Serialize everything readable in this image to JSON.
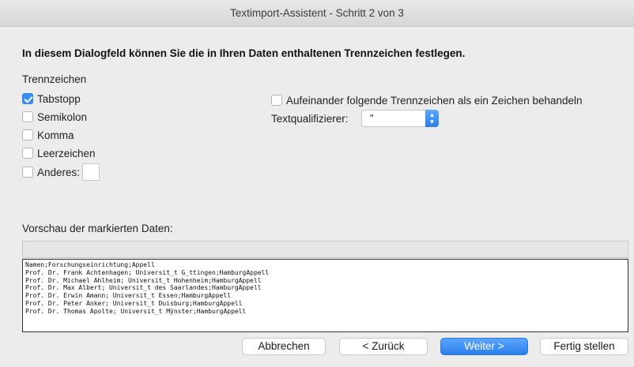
{
  "window": {
    "title": "Textimport-Assistent - Schritt 2 von 3"
  },
  "heading": "In diesem Dialogfeld können Sie die in Ihren Daten enthaltenen Trennzeichen festlegen.",
  "delimiters": {
    "label": "Trennzeichen",
    "items": [
      {
        "label": "Tabstopp",
        "checked": true
      },
      {
        "label": "Semikolon",
        "checked": false
      },
      {
        "label": "Komma",
        "checked": false
      },
      {
        "label": "Leerzeichen",
        "checked": false
      },
      {
        "label": "Anderes:",
        "checked": false
      }
    ]
  },
  "consecutive": {
    "label": "Aufeinander folgende Trennzeichen als ein Zeichen behandeln",
    "checked": false
  },
  "qualifier": {
    "label": "Textqualifizierer:",
    "value": "\""
  },
  "preview": {
    "label": "Vorschau der markierten Daten:",
    "lines": [
      "Namen;Forschungseinrichtung;Appell",
      "Prof. Dr. Frank Achtenhagen; Universit_t G_ttingen;HamburgAppell",
      "Prof. Dr. Michael Ahlheim; Universit_t Hohenheim;HamburgAppell",
      "Prof. Dr. Max Albert; Universit_t des Saarlandes;HamburgAppell",
      "Prof. Dr. Erwin Amann; Universit_t Essen;HamburgAppell",
      "Prof. Dr. Peter Anker; Universit_t Duisburg;HamburgAppell",
      "Prof. Dr. Thomas Apolte; Universit_t Mÿnster;HamburgAppell"
    ]
  },
  "buttons": {
    "cancel": "Abbrechen",
    "back": "< Zurück",
    "next": "Weiter >",
    "finish": "Fertig stellen"
  }
}
